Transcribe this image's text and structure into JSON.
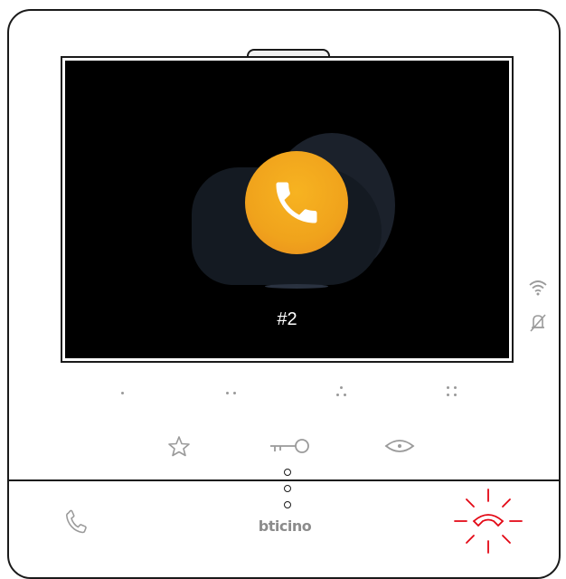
{
  "screen": {
    "caller_label": "#2"
  },
  "brand": {
    "logo_text": "bticino"
  },
  "icons": {
    "call_icon": "phone-handset-icon",
    "wifi_icon": "wifi-icon",
    "bell_icon": "bell-off-icon",
    "favorite_icon": "star-icon",
    "key_icon": "key-icon",
    "eye_icon": "eye-icon",
    "answer_icon": "phone-answer-icon",
    "hangup_icon": "phone-hangup-icon"
  },
  "colors": {
    "call_orange": "#f0a31c",
    "hangup_red": "#e30613",
    "icon_gray": "#9a9a9a"
  }
}
